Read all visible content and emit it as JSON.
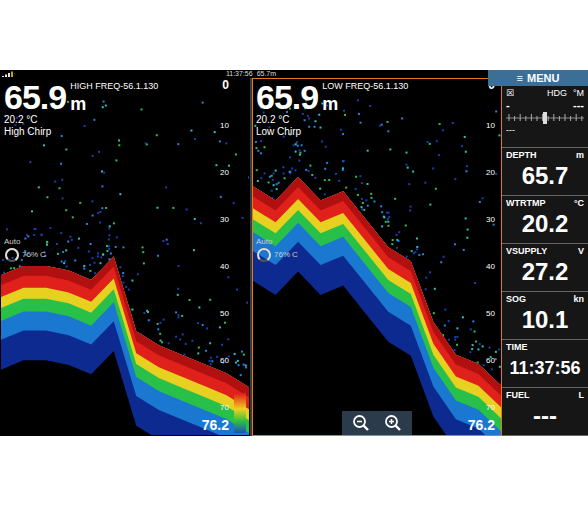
{
  "status_bar": {
    "time": "11:37:56",
    "depth": "65.7m"
  },
  "menu": {
    "icon": "≡",
    "label": "MENU"
  },
  "panels": [
    {
      "title": "HIGH FREQ-56.1.130",
      "depth": "65.9",
      "depth_unit": "m",
      "temp": "20.2 °C",
      "mode": "High Chirp",
      "scale": [
        "0",
        "10",
        "20",
        "30",
        "40",
        "50",
        "60",
        "70"
      ],
      "gain": {
        "label": "Auto",
        "reading": "76%",
        "mode": "C",
        "level": 0.76
      },
      "range": "76.2",
      "selected": false,
      "bottom": [
        42,
        40,
        40,
        41,
        43,
        38,
        54,
        57,
        59,
        61,
        63,
        66
      ]
    },
    {
      "title": "LOW FREQ-56.1.130",
      "depth": "65.9",
      "depth_unit": "m",
      "temp": "20.2 °C",
      "mode": "Low Chirp",
      "scale": [
        "0",
        "10",
        "20",
        "30",
        "40",
        "50",
        "60",
        "70"
      ],
      "gain": {
        "label": "Auto",
        "reading": "76%",
        "mode": "C",
        "level": 0.76
      },
      "range": "76.2",
      "selected": true,
      "bottom": [
        23,
        26,
        21,
        26,
        24,
        30,
        36,
        39,
        52,
        59,
        61,
        65.6
      ]
    }
  ],
  "sidebar": {
    "heading": {
      "icon": "☒",
      "label": "HDG",
      "unit": "°M",
      "value": "-",
      "value2": "---",
      "footer": "---"
    },
    "items": [
      {
        "label": "DEPTH",
        "unit": "m",
        "value": "65.7"
      },
      {
        "label": "WTRTMP",
        "unit": "°C",
        "value": "20.2"
      },
      {
        "label": "VSUPPLY",
        "unit": "V",
        "value": "27.2"
      },
      {
        "label": "SOG",
        "unit": "kn",
        "value": "10.1"
      },
      {
        "label": "TIME",
        "unit": "",
        "value": "11:37:56"
      },
      {
        "label": "FUEL",
        "unit": "L",
        "value": "---"
      }
    ]
  }
}
